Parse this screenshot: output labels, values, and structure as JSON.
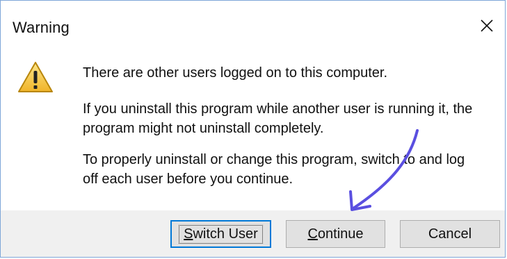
{
  "window": {
    "title": "Warning",
    "close_icon": "close-icon"
  },
  "message": {
    "icon": "warning-icon",
    "line1": "There are other users logged on to this computer.",
    "para2": [
      "If you uninstall this program while another user is running it, the",
      "program might not uninstall completely."
    ],
    "para3": [
      "To properly uninstall or change this program, switch to and log",
      "off each user before you continue."
    ]
  },
  "buttons": {
    "switch_user": {
      "label": "Switch User",
      "mnemonic": "S",
      "rest": "witch User"
    },
    "continue": {
      "label": "Continue",
      "mnemonic": "C",
      "rest": "ontinue"
    },
    "cancel": {
      "label": "Cancel"
    }
  },
  "colors": {
    "annotation_arrow": "#5a4fe0",
    "default_button_border": "#0078d7",
    "warning_fill": "#f7c948"
  }
}
